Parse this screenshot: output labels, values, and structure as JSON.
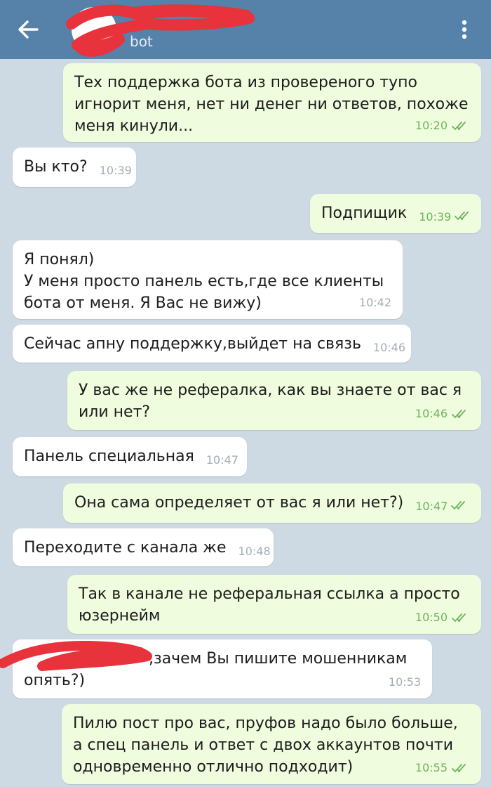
{
  "header": {
    "subtitle": "bot"
  },
  "colors": {
    "header": "#5681a9",
    "background": "#cdd9e3",
    "incoming_bubble": "#ffffff",
    "outgoing_bubble": "#f0fcde",
    "outgoing_time": "#6cb35d",
    "redaction": "#e8323c"
  },
  "icons": [
    "back-arrow-icon",
    "more-vertical-icon",
    "double-check-icon"
  ],
  "messages": [
    {
      "dir": "out",
      "lines": [
        "Тех поддержка бота из провереного тупо",
        "игнорит меня, нет ни денег ни ответов, похоже",
        "меня кинули..."
      ],
      "time": "10:20",
      "read": true
    },
    {
      "dir": "in",
      "lines": [
        "Вы кто?"
      ],
      "time": "10:39"
    },
    {
      "dir": "out",
      "lines": [
        "Подпищик"
      ],
      "time": "10:39",
      "read": true
    },
    {
      "dir": "in",
      "lines": [
        "Я понял)",
        "У меня просто панель есть,где все клиенты",
        "бота от меня. Я Вас не вижу)"
      ],
      "time": "10:42"
    },
    {
      "dir": "in",
      "lines": [
        "Сейчас апну поддержку,выйдет на связь"
      ],
      "time": "10:46"
    },
    {
      "dir": "out",
      "lines": [
        "У вас же не рефералка, как вы знаете от вас я",
        "или нет?"
      ],
      "time": "10:46",
      "read": true
    },
    {
      "dir": "in",
      "lines": [
        "Панель специальная"
      ],
      "time": "10:47"
    },
    {
      "dir": "out",
      "lines": [
        "Она сама определяет от вас я или нет?)"
      ],
      "time": "10:47",
      "read": true
    },
    {
      "dir": "in",
      "lines": [
        "Переходите с канала же"
      ],
      "time": "10:48"
    },
    {
      "dir": "out",
      "lines": [
        "Так в канале не реферальная ссылка а просто",
        "юзернейм"
      ],
      "time": "10:50",
      "read": true
    },
    {
      "dir": "in",
      "lines": [
        ",зачем Вы пишите мошенникам",
        "опять?)"
      ],
      "time": "10:53"
    },
    {
      "dir": "out",
      "lines": [
        "Пилю пост про вас, пруфов надо было больше,",
        "а спец панель и ответ с двох аккаунтов почти",
        "одновременно отлично подходит)"
      ],
      "time": "10:55",
      "read": true
    }
  ]
}
